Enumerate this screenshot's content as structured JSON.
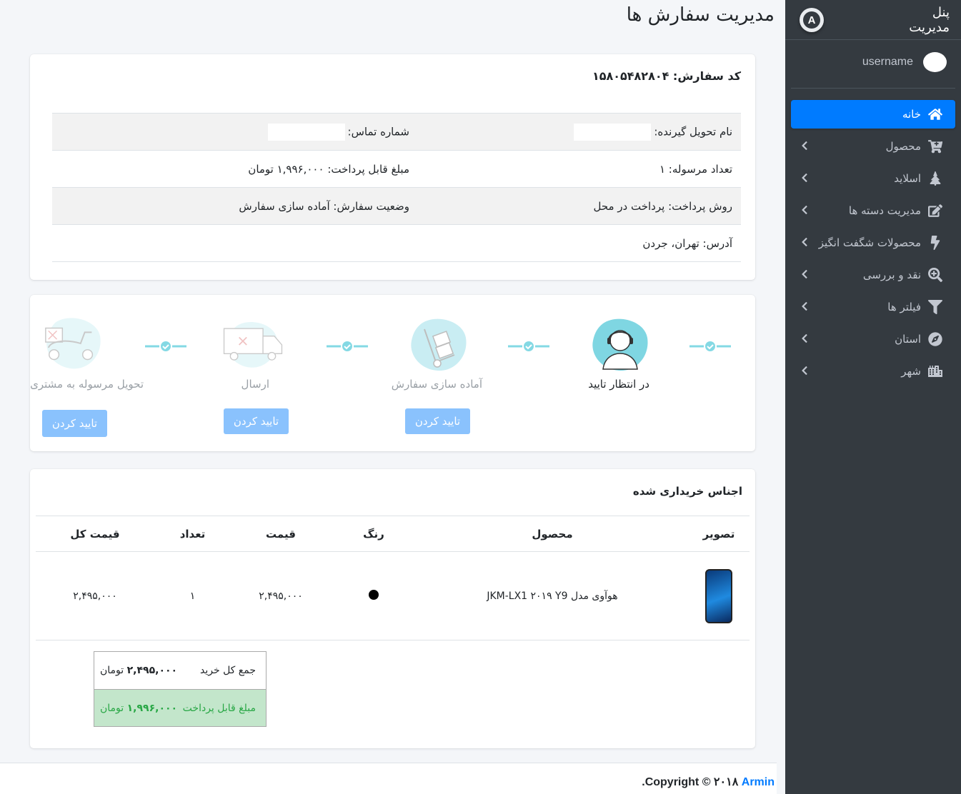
{
  "sidebar": {
    "brand": "پنل مدیریت",
    "logo_letter": "A",
    "username": "username",
    "items": [
      {
        "label": "خانه",
        "icon": "home-icon"
      },
      {
        "label": "محصول",
        "icon": "cart-plus-icon"
      },
      {
        "label": "اسلاید",
        "icon": "tree-icon"
      },
      {
        "label": "مدیریت دسته ها",
        "icon": "edit-icon"
      },
      {
        "label": "محصولات شگفت انگیز",
        "icon": "bolt-icon"
      },
      {
        "label": "نقد و بررسی",
        "icon": "search-plus-icon"
      },
      {
        "label": "فیلتر ها",
        "icon": "filter-icon"
      },
      {
        "label": "استان",
        "icon": "compass-icon"
      },
      {
        "label": "شهر",
        "icon": "city-icon"
      }
    ],
    "active_color": "#007bff"
  },
  "page": {
    "title": "مدیریت سفارش ها"
  },
  "order": {
    "code_label": "کد سفارش: ۱۵۸۰۵۴۸۲۸۰۴",
    "receiver_label": "نام تحویل گیرنده:",
    "phone_label": "شماره تماس:",
    "count_label": "تعداد مرسوله: ۱",
    "payable_label": "مبلغ قابل پرداخت: ۱,۹۹۶,۰۰۰ تومان",
    "payment_label": "روش پرداخت: پرداخت در محل",
    "status_label": "وضعیت سفارش: آماده سازی سفارش",
    "address_label": "آدرس: تهران، جردن"
  },
  "steps": [
    {
      "label": "در انتظار تایید",
      "icon": "headset-user-icon",
      "active": true
    },
    {
      "label": "آماده سازی سفارش",
      "icon": "hand-truck-icon",
      "button": "تایید کردن"
    },
    {
      "label": "ارسال",
      "icon": "delivery-truck-icon",
      "button": "تایید کردن"
    },
    {
      "label": "تحویل مرسوله به مشتری",
      "icon": "scooter-icon",
      "button": "تایید کردن"
    }
  ],
  "items": {
    "title": "اجناس خریداری شده",
    "headers": [
      "تصویر",
      "محصول",
      "رنگ",
      "قیمت",
      "تعداد",
      "قیمت کل"
    ],
    "rows": [
      {
        "product": "هوآوی مدل JKM-LX1 ۲۰۱۹ Y9",
        "color": "#000000",
        "price": "۲,۴۹۵,۰۰۰",
        "qty": "۱",
        "total": "۲,۴۹۵,۰۰۰"
      }
    ],
    "summary": {
      "total_label": "جمع کل خرید",
      "total_value": "۲,۴۹۵,۰۰۰",
      "total_unit": "تومان",
      "payable_label": "مبلغ قابل پرداخت",
      "payable_value": "۱,۹۹۶,۰۰۰",
      "payable_unit": "تومان"
    }
  },
  "footer": {
    "copyright": "Copyright © ۲۰۱۸",
    "author": "Armin",
    "end": "."
  }
}
